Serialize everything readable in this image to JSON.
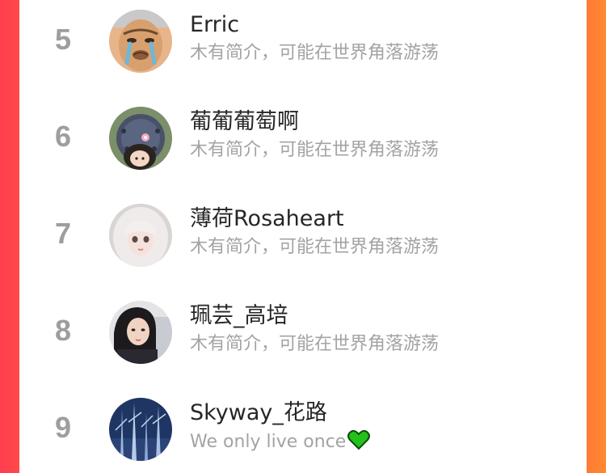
{
  "ranking": {
    "items": [
      {
        "rank": "5",
        "name": "Erric",
        "bio": "木有简介，可能在世界角落游荡",
        "avatar_icon": "crying-meme-face-avatar"
      },
      {
        "rank": "6",
        "name": "葡葡葡萄啊",
        "bio": "木有简介，可能在世界角落游荡",
        "avatar_icon": "cartoon-girl-avatar"
      },
      {
        "rank": "7",
        "name": "薄荷Rosaheart",
        "bio": "木有简介，可能在世界角落游荡",
        "avatar_icon": "white-haired-doll-avatar"
      },
      {
        "rank": "8",
        "name": "珮芸_高培",
        "bio": "木有简介，可能在世界角落游荡",
        "avatar_icon": "girl-selfie-avatar"
      },
      {
        "rank": "9",
        "name": "Skyway_花路",
        "bio": "We only live once",
        "avatar_icon": "frozen-trees-avatar",
        "bio_icon": "green-heart-icon"
      }
    ]
  },
  "colors": {
    "left_edge": "#ff3d4f",
    "right_edge": "#ff7a35",
    "rank_number": "#9e9e9e",
    "name_text": "#262626",
    "bio_text": "#a3a3a3",
    "heart": "#22c21a"
  }
}
